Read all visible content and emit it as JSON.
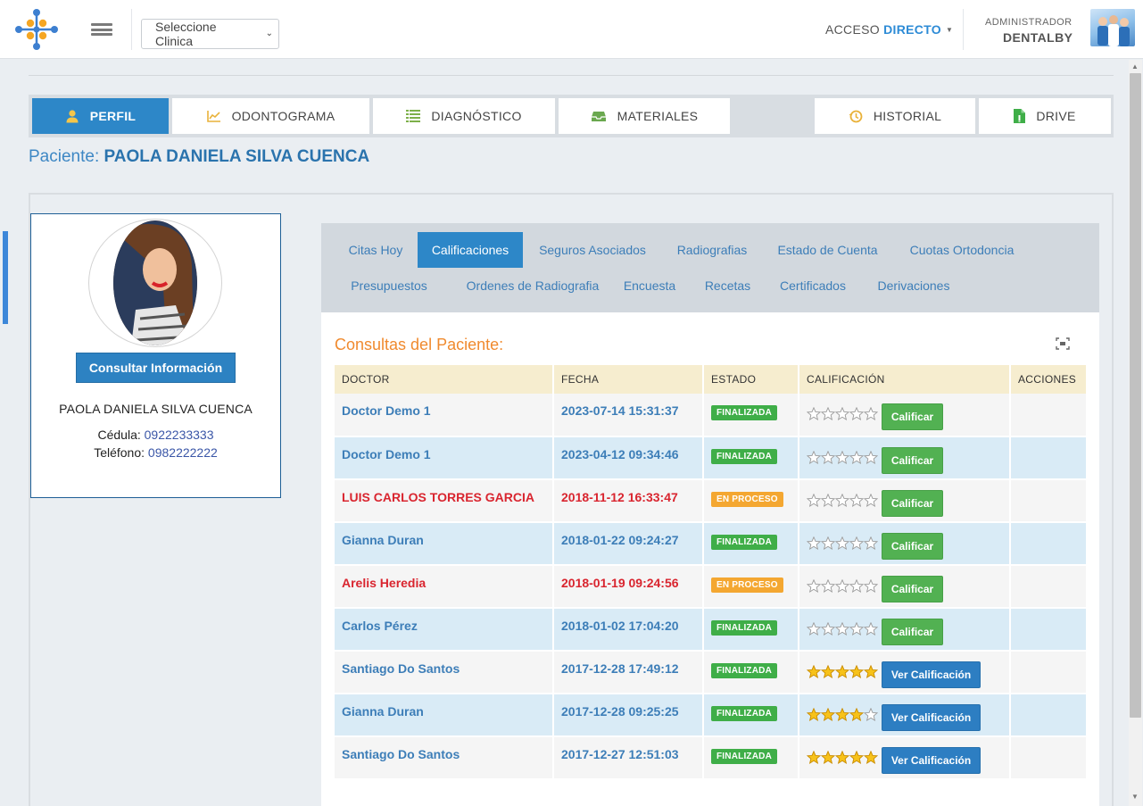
{
  "header": {
    "clinic_select": "Seleccione Clinica",
    "acceso_prefix": "ACCESO ",
    "acceso_highlight": "DIRECTO",
    "admin_role": "ADMINISTRADOR",
    "admin_name": "DENTALBY"
  },
  "main_tabs": [
    {
      "label": "PERFIL",
      "icon": "user-icon"
    },
    {
      "label": "ODONTOGRAMA",
      "icon": "chart-icon"
    },
    {
      "label": "DIAGNÓSTICO",
      "icon": "list-icon"
    },
    {
      "label": "MATERIALES",
      "icon": "inbox-icon"
    },
    {
      "label": "HISTORIAL",
      "icon": "history-icon"
    },
    {
      "label": "DRIVE",
      "icon": "file-icon"
    }
  ],
  "patient": {
    "prefix": "Paciente: ",
    "name": "PAOLA DANIELA SILVA CUENCA",
    "card_name": "PAOLA DANIELA SILVA CUENCA",
    "cedula_label": "Cédula: ",
    "cedula": "0922233333",
    "telefono_label": "Teléfono: ",
    "telefono": "0982222222",
    "consult_button": "Consultar Información"
  },
  "sub_tabs": [
    "Citas Hoy",
    "Calificaciones",
    "Seguros Asociados",
    "Radiografias",
    "Estado de Cuenta",
    "Cuotas Ortodoncia",
    "Presupuestos",
    "Ordenes de Radiografia",
    "Encuesta",
    "Recetas",
    "Certificados",
    "Derivaciones"
  ],
  "panel": {
    "title": "Consultas del Paciente:",
    "columns": [
      "DOCTOR",
      "FECHA",
      "ESTADO",
      "CALIFICACIÓN",
      "ACCIONES"
    ],
    "rows": [
      {
        "doctor": "Doctor Demo 1",
        "fecha": "2023-07-14 15:31:37",
        "estado": "FINALIZADA",
        "stars": 0,
        "button": "Calificar"
      },
      {
        "doctor": "Doctor Demo 1",
        "fecha": "2023-04-12 09:34:46",
        "estado": "FINALIZADA",
        "stars": 0,
        "button": "Calificar"
      },
      {
        "doctor": "LUIS CARLOS TORRES GARCIA",
        "fecha": "2018-11-12 16:33:47",
        "estado": "EN PROCESO",
        "stars": 0,
        "button": "Calificar"
      },
      {
        "doctor": "Gianna Duran",
        "fecha": "2018-01-22 09:24:27",
        "estado": "FINALIZADA",
        "stars": 0,
        "button": "Calificar"
      },
      {
        "doctor": "Arelis Heredia",
        "fecha": "2018-01-19 09:24:56",
        "estado": "EN PROCESO",
        "stars": 0,
        "button": "Calificar"
      },
      {
        "doctor": "Carlos Pérez",
        "fecha": "2018-01-02 17:04:20",
        "estado": "FINALIZADA",
        "stars": 0,
        "button": "Calificar"
      },
      {
        "doctor": "Santiago Do Santos",
        "fecha": "2017-12-28 17:49:12",
        "estado": "FINALIZADA",
        "stars": 5,
        "button": "Ver Calificación"
      },
      {
        "doctor": "Gianna Duran",
        "fecha": "2017-12-28 09:25:25",
        "estado": "FINALIZADA",
        "stars": 4,
        "button": "Ver Calificación"
      },
      {
        "doctor": "Santiago Do Santos",
        "fecha": "2017-12-27 12:51:03",
        "estado": "FINALIZADA",
        "stars": 5,
        "button": "Ver Calificación"
      }
    ]
  },
  "colors": {
    "primary": "#2d87c8",
    "accent_orange": "#f08a2e",
    "finalizada": "#3fae48",
    "en_proceso": "#f4a731",
    "doctor_in_process": "#d9252f"
  }
}
